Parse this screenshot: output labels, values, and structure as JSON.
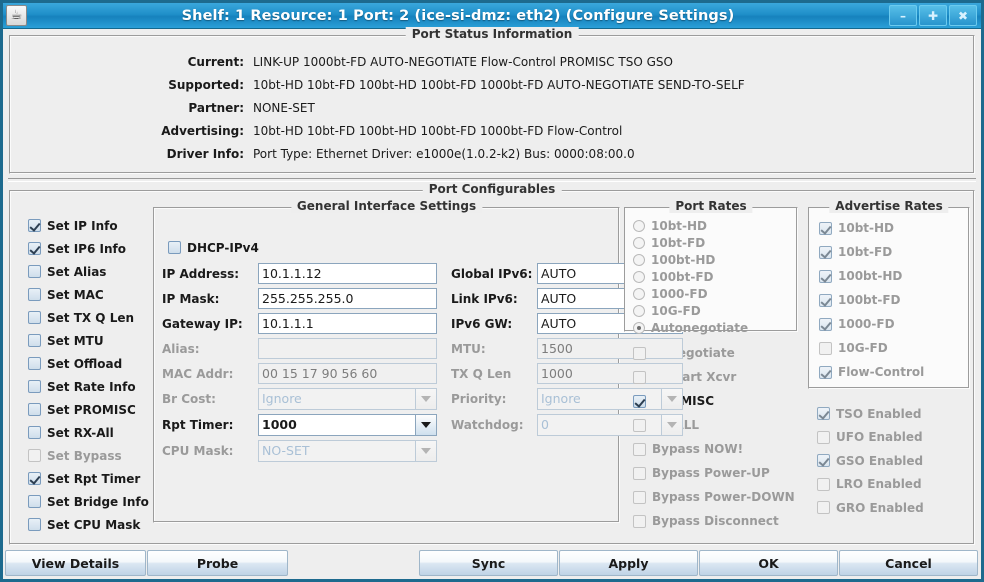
{
  "window": {
    "title": "Shelf: 1  Resource: 1  Port: 2  (ice-si-dmz: eth2)  (Configure Settings)",
    "icon": "java-cup-icon",
    "minimize_label": "–",
    "maximize_label": "✚",
    "close_label": "✖",
    "titlebar_color": "#1f8fc9",
    "border_color": "#1d6a8e"
  },
  "port_status": {
    "title": "Port Status Information",
    "rows": [
      {
        "label": "Current:",
        "value": "LINK-UP 1000bt-FD AUTO-NEGOTIATE Flow-Control PROMISC TSO GSO"
      },
      {
        "label": "Supported:",
        "value": "10bt-HD 10bt-FD 100bt-HD 100bt-FD 1000bt-FD AUTO-NEGOTIATE SEND-TO-SELF"
      },
      {
        "label": "Partner:",
        "value": "NONE-SET"
      },
      {
        "label": "Advertising:",
        "value": "10bt-HD 10bt-FD 100bt-HD 100bt-FD 1000bt-FD Flow-Control"
      },
      {
        "label": "Driver Info:",
        "value": "Port Type: Ethernet   Driver: e1000e(1.0.2-k2)  Bus: 0000:08:00.0"
      }
    ]
  },
  "port_configurables": {
    "title": "Port Configurables",
    "set_flags": [
      {
        "label": "Set IP Info",
        "checked": true,
        "disabled": false
      },
      {
        "label": "Set IP6 Info",
        "checked": true,
        "disabled": false
      },
      {
        "label": "Set Alias",
        "checked": false,
        "disabled": false
      },
      {
        "label": "Set MAC",
        "checked": false,
        "disabled": false
      },
      {
        "label": "Set TX Q Len",
        "checked": false,
        "disabled": false
      },
      {
        "label": "Set MTU",
        "checked": false,
        "disabled": false
      },
      {
        "label": "Set Offload",
        "checked": false,
        "disabled": false
      },
      {
        "label": "Set Rate Info",
        "checked": false,
        "disabled": false
      },
      {
        "label": "Set PROMISC",
        "checked": false,
        "disabled": false
      },
      {
        "label": "Set RX-All",
        "checked": false,
        "disabled": false
      },
      {
        "label": "Set Bypass",
        "checked": false,
        "disabled": true
      },
      {
        "label": "Set Rpt Timer",
        "checked": true,
        "disabled": false
      },
      {
        "label": "Set Bridge Info",
        "checked": false,
        "disabled": false
      },
      {
        "label": "Set CPU Mask",
        "checked": false,
        "disabled": false
      }
    ],
    "general_interface": {
      "title": "General Interface Settings",
      "dhcp_ipv4": {
        "label": "DHCP-IPv4",
        "checked": false,
        "disabled": false
      },
      "fields": {
        "ip_address": {
          "label": "IP Address:",
          "value": "10.1.1.12",
          "disabled": false
        },
        "ip_mask": {
          "label": "IP Mask:",
          "value": "255.255.255.0",
          "disabled": false
        },
        "gateway_ip": {
          "label": "Gateway IP:",
          "value": "10.1.1.1",
          "disabled": false
        },
        "alias": {
          "label": "Alias:",
          "value": "",
          "disabled": true
        },
        "mac_addr": {
          "label": "MAC Addr:",
          "value": "00 15 17 90 56 60",
          "disabled": true
        },
        "br_cost": {
          "label": "Br Cost:",
          "value": "Ignore",
          "disabled": true
        },
        "rpt_timer": {
          "label": "Rpt Timer:",
          "value": "1000",
          "disabled": false
        },
        "cpu_mask": {
          "label": "CPU Mask:",
          "value": "NO-SET",
          "disabled": true
        },
        "global_ipv6": {
          "label": "Global IPv6:",
          "value": "AUTO",
          "disabled": false
        },
        "link_ipv6": {
          "label": "Link IPv6:",
          "value": "AUTO",
          "disabled": false
        },
        "ipv6_gw": {
          "label": "IPv6 GW:",
          "value": "AUTO",
          "disabled": false
        },
        "mtu": {
          "label": "MTU:",
          "value": "1500",
          "disabled": true
        },
        "tx_q_len": {
          "label": "TX Q Len",
          "value": "1000",
          "disabled": true
        },
        "priority": {
          "label": "Priority:",
          "value": "Ignore",
          "disabled": true
        },
        "watchdog": {
          "label": "Watchdog:",
          "value": "0",
          "disabled": true
        }
      }
    },
    "port_rates": {
      "title": "Port Rates",
      "options": [
        {
          "label": "10bt-HD",
          "selected": false
        },
        {
          "label": "10bt-FD",
          "selected": false
        },
        {
          "label": "100bt-HD",
          "selected": false
        },
        {
          "label": "100bt-FD",
          "selected": false
        },
        {
          "label": "1000-FD",
          "selected": false
        },
        {
          "label": "10G-FD",
          "selected": false
        },
        {
          "label": "Autonegotiate",
          "selected": true
        }
      ]
    },
    "advertise_rates": {
      "title": "Advertise Rates",
      "options": [
        {
          "label": "10bt-HD",
          "checked": true
        },
        {
          "label": "10bt-FD",
          "checked": true
        },
        {
          "label": "100bt-HD",
          "checked": true
        },
        {
          "label": "100bt-FD",
          "checked": true
        },
        {
          "label": "1000-FD",
          "checked": true
        },
        {
          "label": "10G-FD",
          "checked": false
        },
        {
          "label": "Flow-Control",
          "checked": true
        }
      ]
    },
    "action_flags": [
      {
        "label": "Renegotiate",
        "checked": false,
        "disabled": true
      },
      {
        "label": "Restart Xcvr",
        "checked": false,
        "disabled": true
      },
      {
        "label": "PROMISC",
        "checked": true,
        "disabled": false
      },
      {
        "label": "RX-ALL",
        "checked": false,
        "disabled": true
      },
      {
        "label": "Bypass NOW!",
        "checked": false,
        "disabled": true
      },
      {
        "label": "Bypass Power-UP",
        "checked": false,
        "disabled": true
      },
      {
        "label": "Bypass Power-DOWN",
        "checked": false,
        "disabled": true
      },
      {
        "label": "Bypass Disconnect",
        "checked": false,
        "disabled": true
      }
    ],
    "offload_flags": [
      {
        "label": "TSO Enabled",
        "checked": true,
        "disabled": true
      },
      {
        "label": "UFO Enabled",
        "checked": false,
        "disabled": true
      },
      {
        "label": "GSO Enabled",
        "checked": true,
        "disabled": true
      },
      {
        "label": "LRO Enabled",
        "checked": false,
        "disabled": true
      },
      {
        "label": "GRO Enabled",
        "checked": false,
        "disabled": true
      }
    ]
  },
  "buttons": {
    "view_details": "View Details",
    "probe": "Probe",
    "sync": "Sync",
    "apply": "Apply",
    "ok": "OK",
    "cancel": "Cancel"
  }
}
